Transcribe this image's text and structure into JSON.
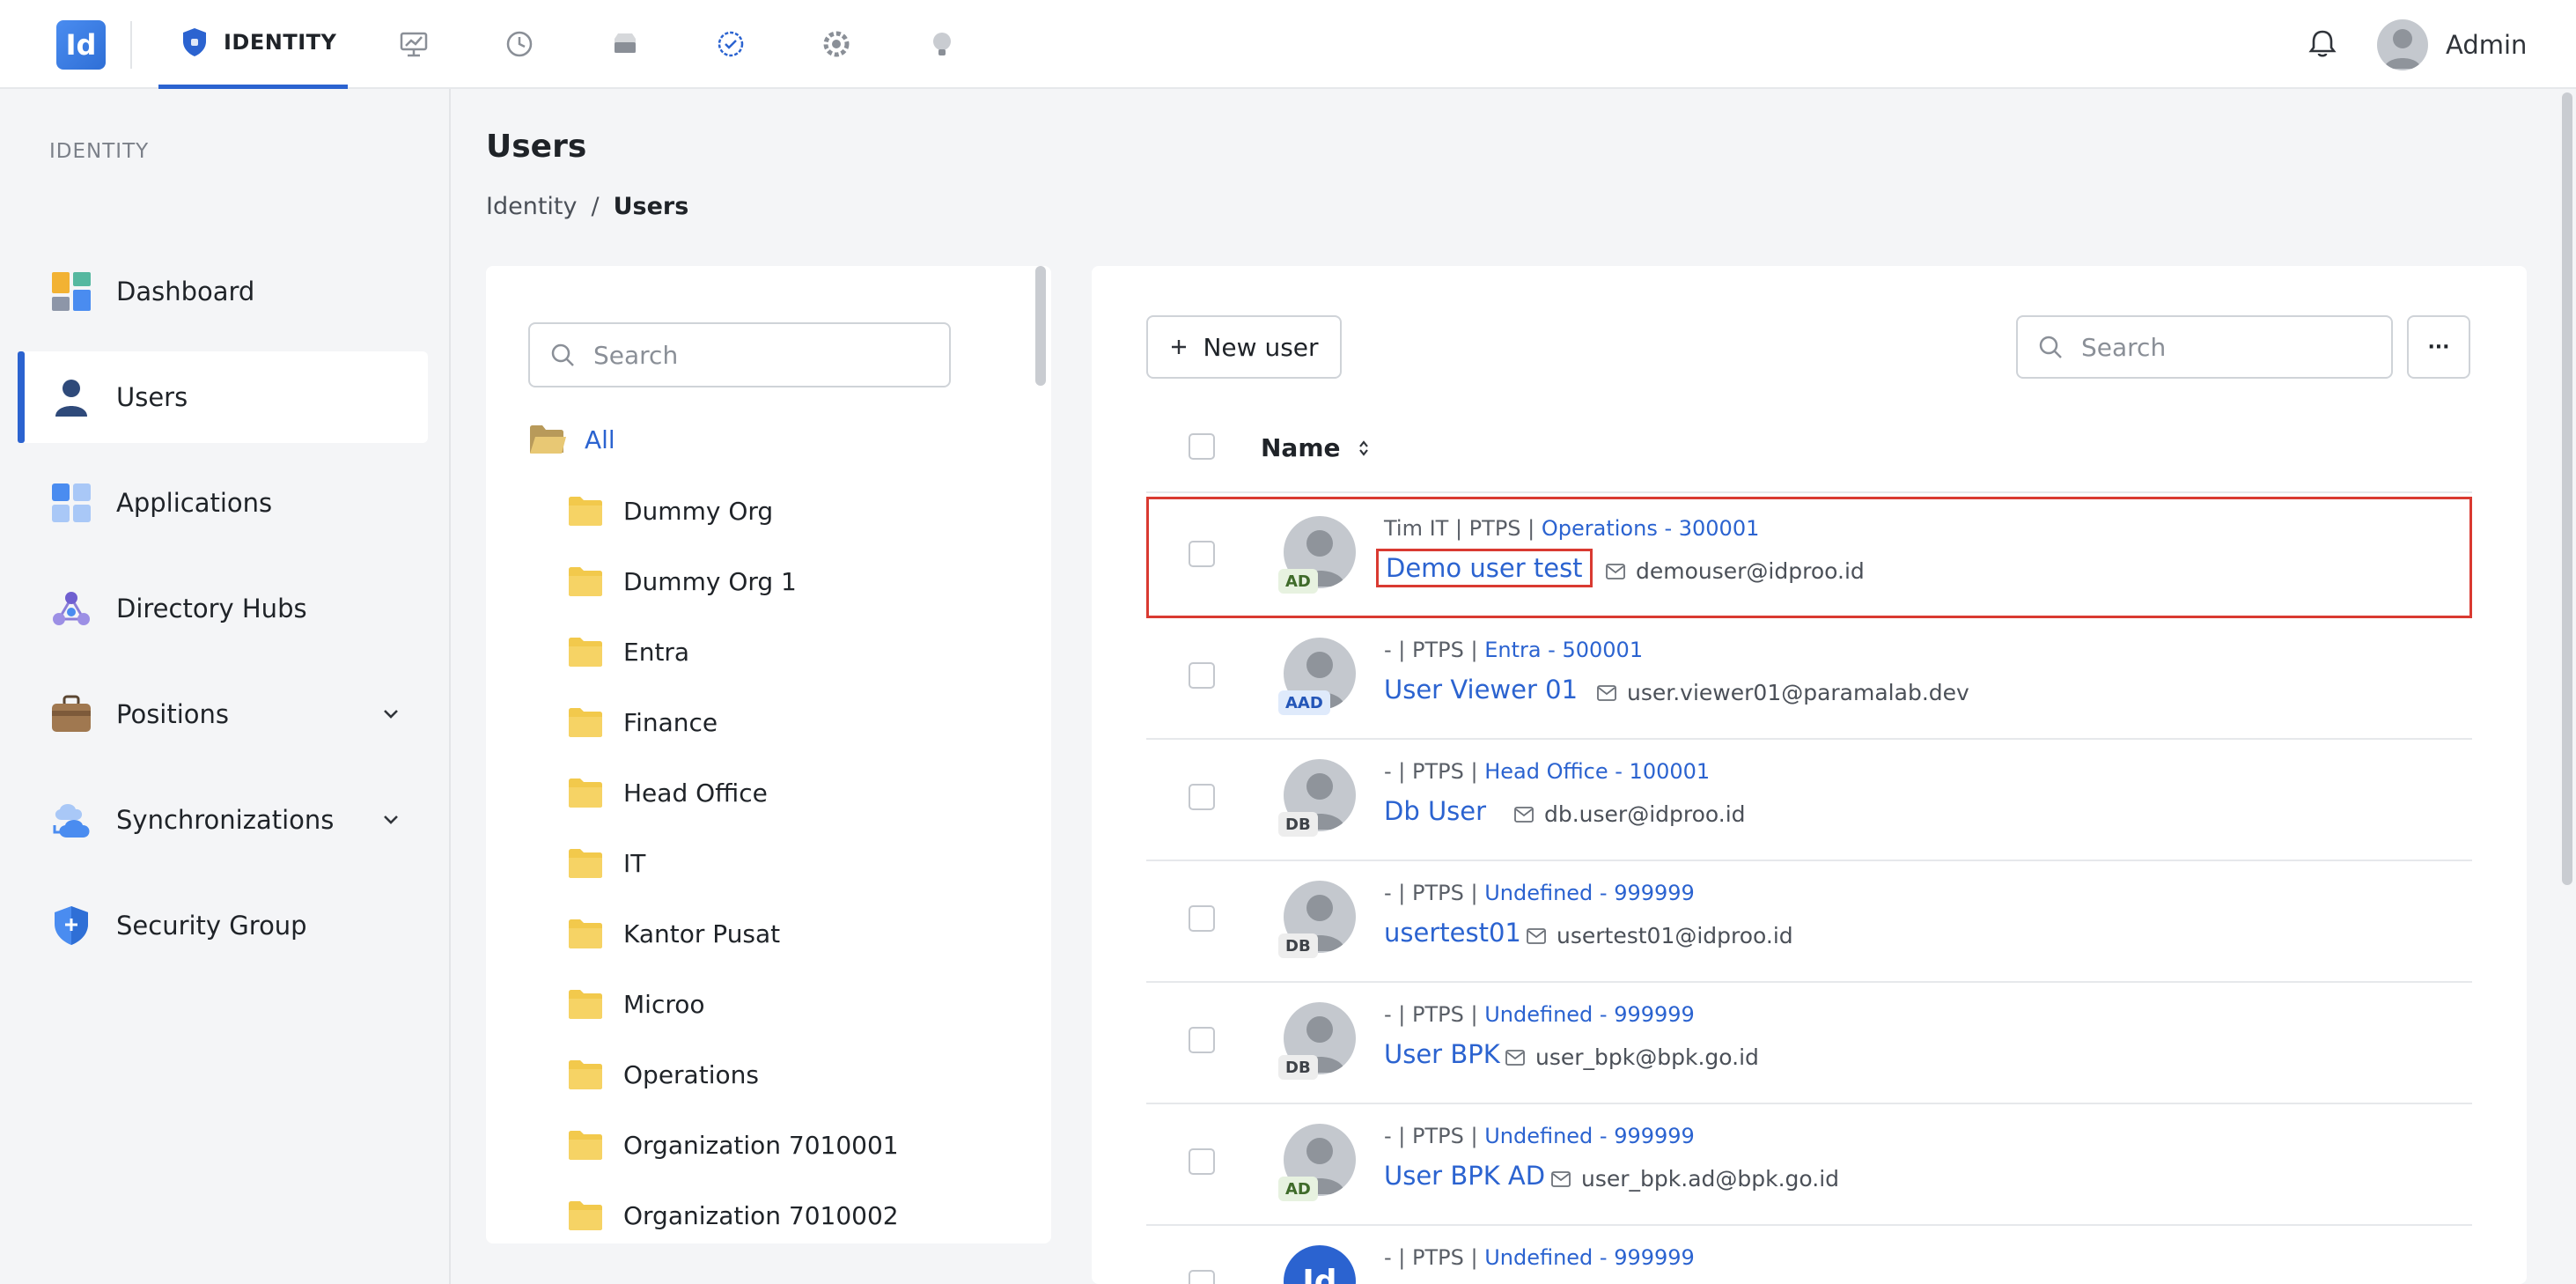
{
  "app": {
    "logo_text": "Id"
  },
  "topbar": {
    "active_tab": "IDENTITY",
    "tab_icons": [
      "dashboard-icon",
      "history-icon",
      "storage-icon",
      "check-badge-icon",
      "settings-icon",
      "bulb-icon"
    ],
    "user_name": "Admin"
  },
  "sidebar": {
    "section_title": "IDENTITY",
    "items": [
      {
        "label": "Dashboard",
        "icon": "dashboard-icon"
      },
      {
        "label": "Users",
        "icon": "user-icon"
      },
      {
        "label": "Applications",
        "icon": "applications-icon"
      },
      {
        "label": "Directory Hubs",
        "icon": "directory-hub-icon"
      },
      {
        "label": "Positions",
        "icon": "briefcase-icon"
      },
      {
        "label": "Synchronizations",
        "icon": "cloud-sync-icon"
      },
      {
        "label": "Security Group",
        "icon": "shield-icon"
      }
    ]
  },
  "main": {
    "title": "Users",
    "breadcrumb": {
      "root": "Identity",
      "separator": "/",
      "current": "Users"
    }
  },
  "tree": {
    "search_placeholder": "Search",
    "all_label": "All",
    "items": [
      "Dummy Org",
      "Dummy Org 1",
      "Entra",
      "Finance",
      "Head Office",
      "IT",
      "Kantor Pusat",
      "Microo",
      "Operations",
      "Organization 7010001",
      "Organization 7010002"
    ]
  },
  "users": {
    "new_user_label": "New user",
    "search_placeholder": "Search",
    "more_label": "···",
    "column_name": "Name",
    "rows": [
      {
        "meta": "Tim IT | PTPS | ",
        "dept": "Operations - 300001",
        "name": "Demo user test",
        "email": "demouser@idproo.id",
        "source": "AD"
      },
      {
        "meta": "- | PTPS | ",
        "dept": "Entra - 500001",
        "name": "User Viewer 01",
        "email": "user.viewer01@paramalab.dev",
        "source": "AAD"
      },
      {
        "meta": "- | PTPS | ",
        "dept": "Head Office - 100001",
        "name": "Db User",
        "email": "db.user@idproo.id",
        "source": "DB"
      },
      {
        "meta": "- | PTPS | ",
        "dept": "Undefined - 999999",
        "name": "usertest01",
        "email": "usertest01@idproo.id",
        "source": "DB"
      },
      {
        "meta": "- | PTPS | ",
        "dept": "Undefined - 999999",
        "name": "User BPK",
        "email": "user_bpk@bpk.go.id",
        "source": "DB"
      },
      {
        "meta": "- | PTPS | ",
        "dept": "Undefined - 999999",
        "name": "User BPK AD",
        "email": "user_bpk.ad@bpk.go.id",
        "source": "AD"
      },
      {
        "meta": "- | PTPS | ",
        "dept": "Undefined - 999999",
        "avatar_text": "Id"
      }
    ]
  },
  "colors": {
    "accent": "#2b63d0",
    "highlight": "#d93a31",
    "folder": "#f2c94c"
  }
}
